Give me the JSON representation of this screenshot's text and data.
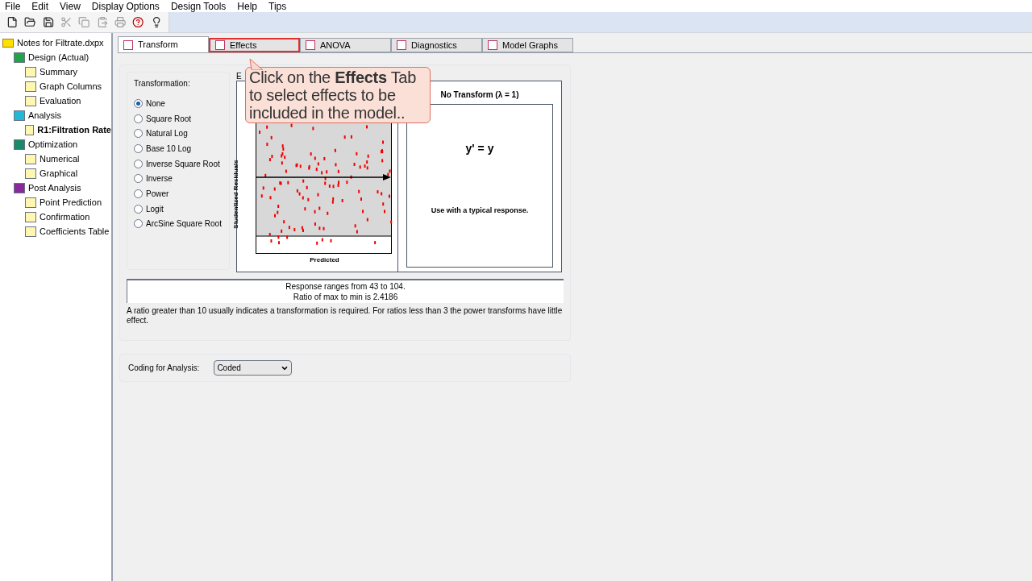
{
  "menu": [
    "File",
    "Edit",
    "View",
    "Display Options",
    "Design Tools",
    "Help",
    "Tips"
  ],
  "toolbar": [
    {
      "kind": "new",
      "disabled": false
    },
    {
      "kind": "open",
      "disabled": false
    },
    {
      "kind": "save",
      "disabled": false
    },
    {
      "kind": "cut",
      "disabled": true
    },
    {
      "kind": "copy",
      "disabled": true
    },
    {
      "kind": "paste",
      "disabled": true
    },
    {
      "kind": "print",
      "disabled": true
    },
    {
      "kind": "help",
      "disabled": false
    },
    {
      "kind": "tip",
      "disabled": false
    }
  ],
  "tree": {
    "label": "Notes for Filtrate.dxpx",
    "children": [
      {
        "label": "Design (Actual)",
        "selected": false,
        "children": [
          {
            "label": "Summary",
            "selected": false
          },
          {
            "label": "Graph Columns",
            "selected": false
          },
          {
            "label": "Evaluation",
            "selected": false
          }
        ]
      },
      {
        "label": "Analysis",
        "selected": false,
        "children": [
          {
            "label": "R1:Filtration Rate",
            "selected": true
          }
        ]
      },
      {
        "label": "Optimization",
        "selected": false,
        "children": [
          {
            "label": "Numerical",
            "selected": false
          },
          {
            "label": "Graphical",
            "selected": false
          }
        ]
      },
      {
        "label": "Post Analysis",
        "selected": false,
        "children": [
          {
            "label": "Point Prediction",
            "selected": false
          },
          {
            "label": "Confirmation",
            "selected": false
          },
          {
            "label": "Coefficients Table",
            "selected": false
          }
        ]
      }
    ]
  },
  "tabs": [
    {
      "label": "Transform",
      "selected": true,
      "highlighted": false
    },
    {
      "label": "Effects",
      "selected": false,
      "highlighted": true
    },
    {
      "label": "ANOVA",
      "selected": false,
      "highlighted": false
    },
    {
      "label": "Diagnostics",
      "selected": false,
      "highlighted": false
    },
    {
      "label": "Model Graphs",
      "selected": false,
      "highlighted": false
    }
  ],
  "transformation": {
    "title": "Transformation:",
    "options": [
      {
        "label": "None",
        "selected": true
      },
      {
        "label": "Square Root",
        "selected": false
      },
      {
        "label": "Natural Log",
        "selected": false
      },
      {
        "label": "Base 10 Log",
        "selected": false
      },
      {
        "label": "Inverse Square Root",
        "selected": false
      },
      {
        "label": "Inverse",
        "selected": false
      },
      {
        "label": "Power",
        "selected": false
      },
      {
        "label": "Logit",
        "selected": false
      },
      {
        "label": "ArcSine Square Root",
        "selected": false
      }
    ]
  },
  "plot": {
    "group_label": "E",
    "ylabel": "Studentized Residuals",
    "xlabel": "Predicted"
  },
  "transform_info": {
    "title": "No Transform (λ = 1)",
    "formula": "y' = y",
    "note": "Use with a typical response."
  },
  "response": [
    "Response ranges from 43 to 104.",
    "Ratio of max to min is 2.4186"
  ],
  "advice": "A ratio greater than 10 usually indicates a transformation is required.  For ratios less than 3 the power transforms have little effect.",
  "coding": {
    "label": "Coding for Analysis:",
    "value": "Coded"
  },
  "callout": "Click on the **Effects** Tab to select effects to be included in the model.."
}
